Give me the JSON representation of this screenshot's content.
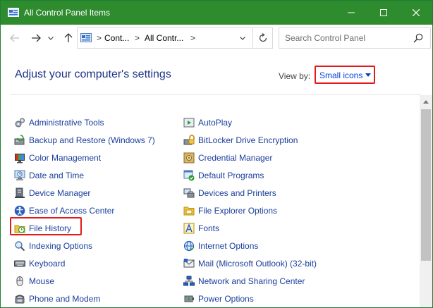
{
  "window": {
    "title": "All Control Panel Items",
    "colors": {
      "titlebar": "#2e8b2e",
      "link": "#1a3e9a",
      "heading": "#1e3287",
      "highlight": "#e11b1b"
    }
  },
  "icons": {
    "app": "control-panel-icon",
    "minimize": "minimize-icon",
    "maximize": "maximize-icon",
    "close": "close-icon",
    "back": "arrow-left-icon",
    "forward": "arrow-right-icon",
    "recent": "chevron-down-icon",
    "up": "arrow-up-icon",
    "refresh": "refresh-icon",
    "search": "search-icon"
  },
  "address": {
    "crumbs": [
      "Cont...",
      "All Contr..."
    ],
    "separator": ">"
  },
  "search": {
    "placeholder": "Search Control Panel"
  },
  "page": {
    "heading": "Adjust your computer's settings",
    "view_by_label": "View by:",
    "view_by_value": "Small icons"
  },
  "items": {
    "left": [
      {
        "label": "Administrative Tools",
        "icon": "administrative-tools-icon"
      },
      {
        "label": "Backup and Restore (Windows 7)",
        "icon": "backup-restore-icon"
      },
      {
        "label": "Color Management",
        "icon": "color-management-icon"
      },
      {
        "label": "Date and Time",
        "icon": "date-time-icon"
      },
      {
        "label": "Device Manager",
        "icon": "device-manager-icon"
      },
      {
        "label": "Ease of Access Center",
        "icon": "ease-of-access-icon"
      },
      {
        "label": "File History",
        "icon": "file-history-icon"
      },
      {
        "label": "Indexing Options",
        "icon": "indexing-options-icon"
      },
      {
        "label": "Keyboard",
        "icon": "keyboard-icon"
      },
      {
        "label": "Mouse",
        "icon": "mouse-icon"
      },
      {
        "label": "Phone and Modem",
        "icon": "phone-modem-icon"
      }
    ],
    "right": [
      {
        "label": "AutoPlay",
        "icon": "autoplay-icon"
      },
      {
        "label": "BitLocker Drive Encryption",
        "icon": "bitlocker-icon"
      },
      {
        "label": "Credential Manager",
        "icon": "credential-manager-icon"
      },
      {
        "label": "Default Programs",
        "icon": "default-programs-icon"
      },
      {
        "label": "Devices and Printers",
        "icon": "devices-printers-icon"
      },
      {
        "label": "File Explorer Options",
        "icon": "file-explorer-options-icon"
      },
      {
        "label": "Fonts",
        "icon": "fonts-icon"
      },
      {
        "label": "Internet Options",
        "icon": "internet-options-icon"
      },
      {
        "label": "Mail (Microsoft Outlook) (32-bit)",
        "icon": "mail-icon"
      },
      {
        "label": "Network and Sharing Center",
        "icon": "network-sharing-icon"
      },
      {
        "label": "Power Options",
        "icon": "power-options-icon"
      }
    ]
  }
}
